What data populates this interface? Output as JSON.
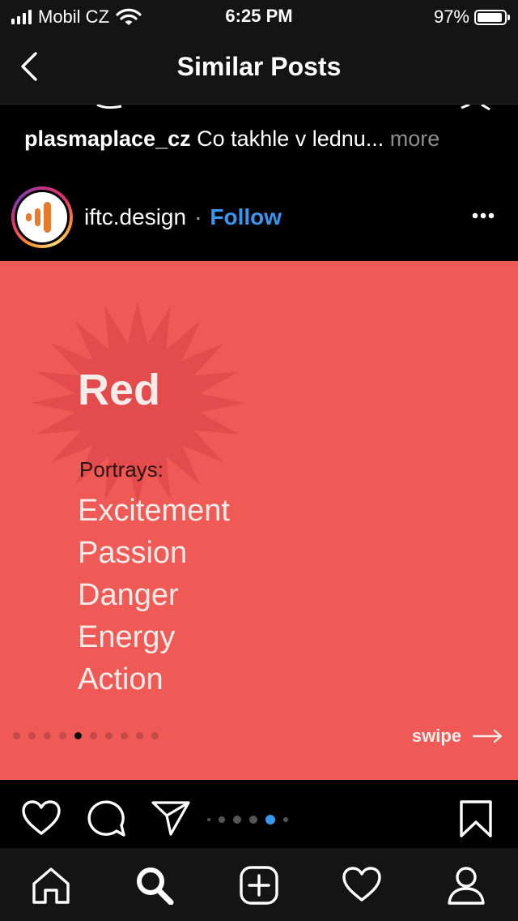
{
  "status_bar": {
    "carrier": "Mobil CZ",
    "time": "6:25 PM",
    "battery_percent": "97%",
    "signal_icon": "signal-bars-icon",
    "wifi_icon": "wifi-icon",
    "battery_icon": "battery-icon"
  },
  "nav": {
    "title": "Similar Posts",
    "back_icon": "chevron-left-icon"
  },
  "previous_post": {
    "username": "plasmaplace_cz",
    "caption": "Co takhle v lednu...",
    "more_label": "more"
  },
  "post": {
    "username": "iftc.design",
    "separator": "·",
    "follow_label": "Follow",
    "more_icon": "ellipsis-icon",
    "image": {
      "title": "Red",
      "subtitle": "Portrays:",
      "items": [
        "Excitement",
        "Passion",
        "Danger",
        "Energy",
        "Action"
      ],
      "swipe_label": "swipe",
      "background_color": "#ef5a56"
    },
    "in_image_pagination": {
      "total": 10,
      "active_index": 4
    },
    "carousel_pagination": {
      "total": 6,
      "active_index": 4
    }
  },
  "actions": {
    "like_icon": "heart-icon",
    "comment_icon": "comment-icon",
    "share_icon": "paper-plane-icon",
    "save_icon": "bookmark-icon"
  },
  "tab_bar": {
    "items": [
      "home-icon",
      "search-icon",
      "add-post-icon",
      "activity-heart-icon",
      "profile-icon"
    ],
    "active": "search-icon"
  },
  "colors": {
    "link_blue": "#3897f0",
    "muted_gray": "#8e8e8e",
    "bar_background": "#141414"
  }
}
